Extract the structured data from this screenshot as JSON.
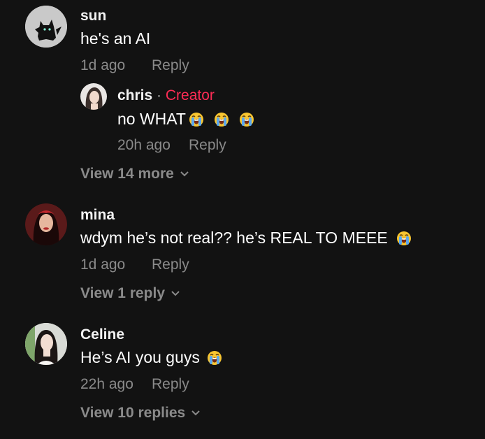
{
  "comments": [
    {
      "username": "sun",
      "text": "he's an AI",
      "time": "1d ago",
      "reply_label": "Reply",
      "replies": [
        {
          "username": "chris",
          "separator": "·",
          "creator_label": "Creator",
          "text": "no WHAT",
          "emojis": [
            "loudly-crying-face",
            "loudly-crying-face",
            "loudly-crying-face"
          ],
          "time": "20h ago",
          "reply_label": "Reply"
        }
      ],
      "view_more_label": "View 14 more"
    },
    {
      "username": "mina",
      "text": "wdym he’s not real?? he’s REAL TO MEEE",
      "emojis": [
        "loudly-crying-face"
      ],
      "time": "1d ago",
      "reply_label": "Reply",
      "view_more_label": "View 1 reply"
    },
    {
      "username": "Celine",
      "text": "He’s AI you guys",
      "emojis": [
        "loudly-crying-face"
      ],
      "time": "22h ago",
      "reply_label": "Reply",
      "view_more_label": "View 10 replies"
    }
  ],
  "colors": {
    "background": "#121212",
    "username": "#f2f2f2",
    "meta": "#8a8a8a",
    "creator": "#fe2c55"
  },
  "icons": {
    "expand": "chevron-down-icon",
    "emoji": "loudly-crying-face-emoji"
  }
}
